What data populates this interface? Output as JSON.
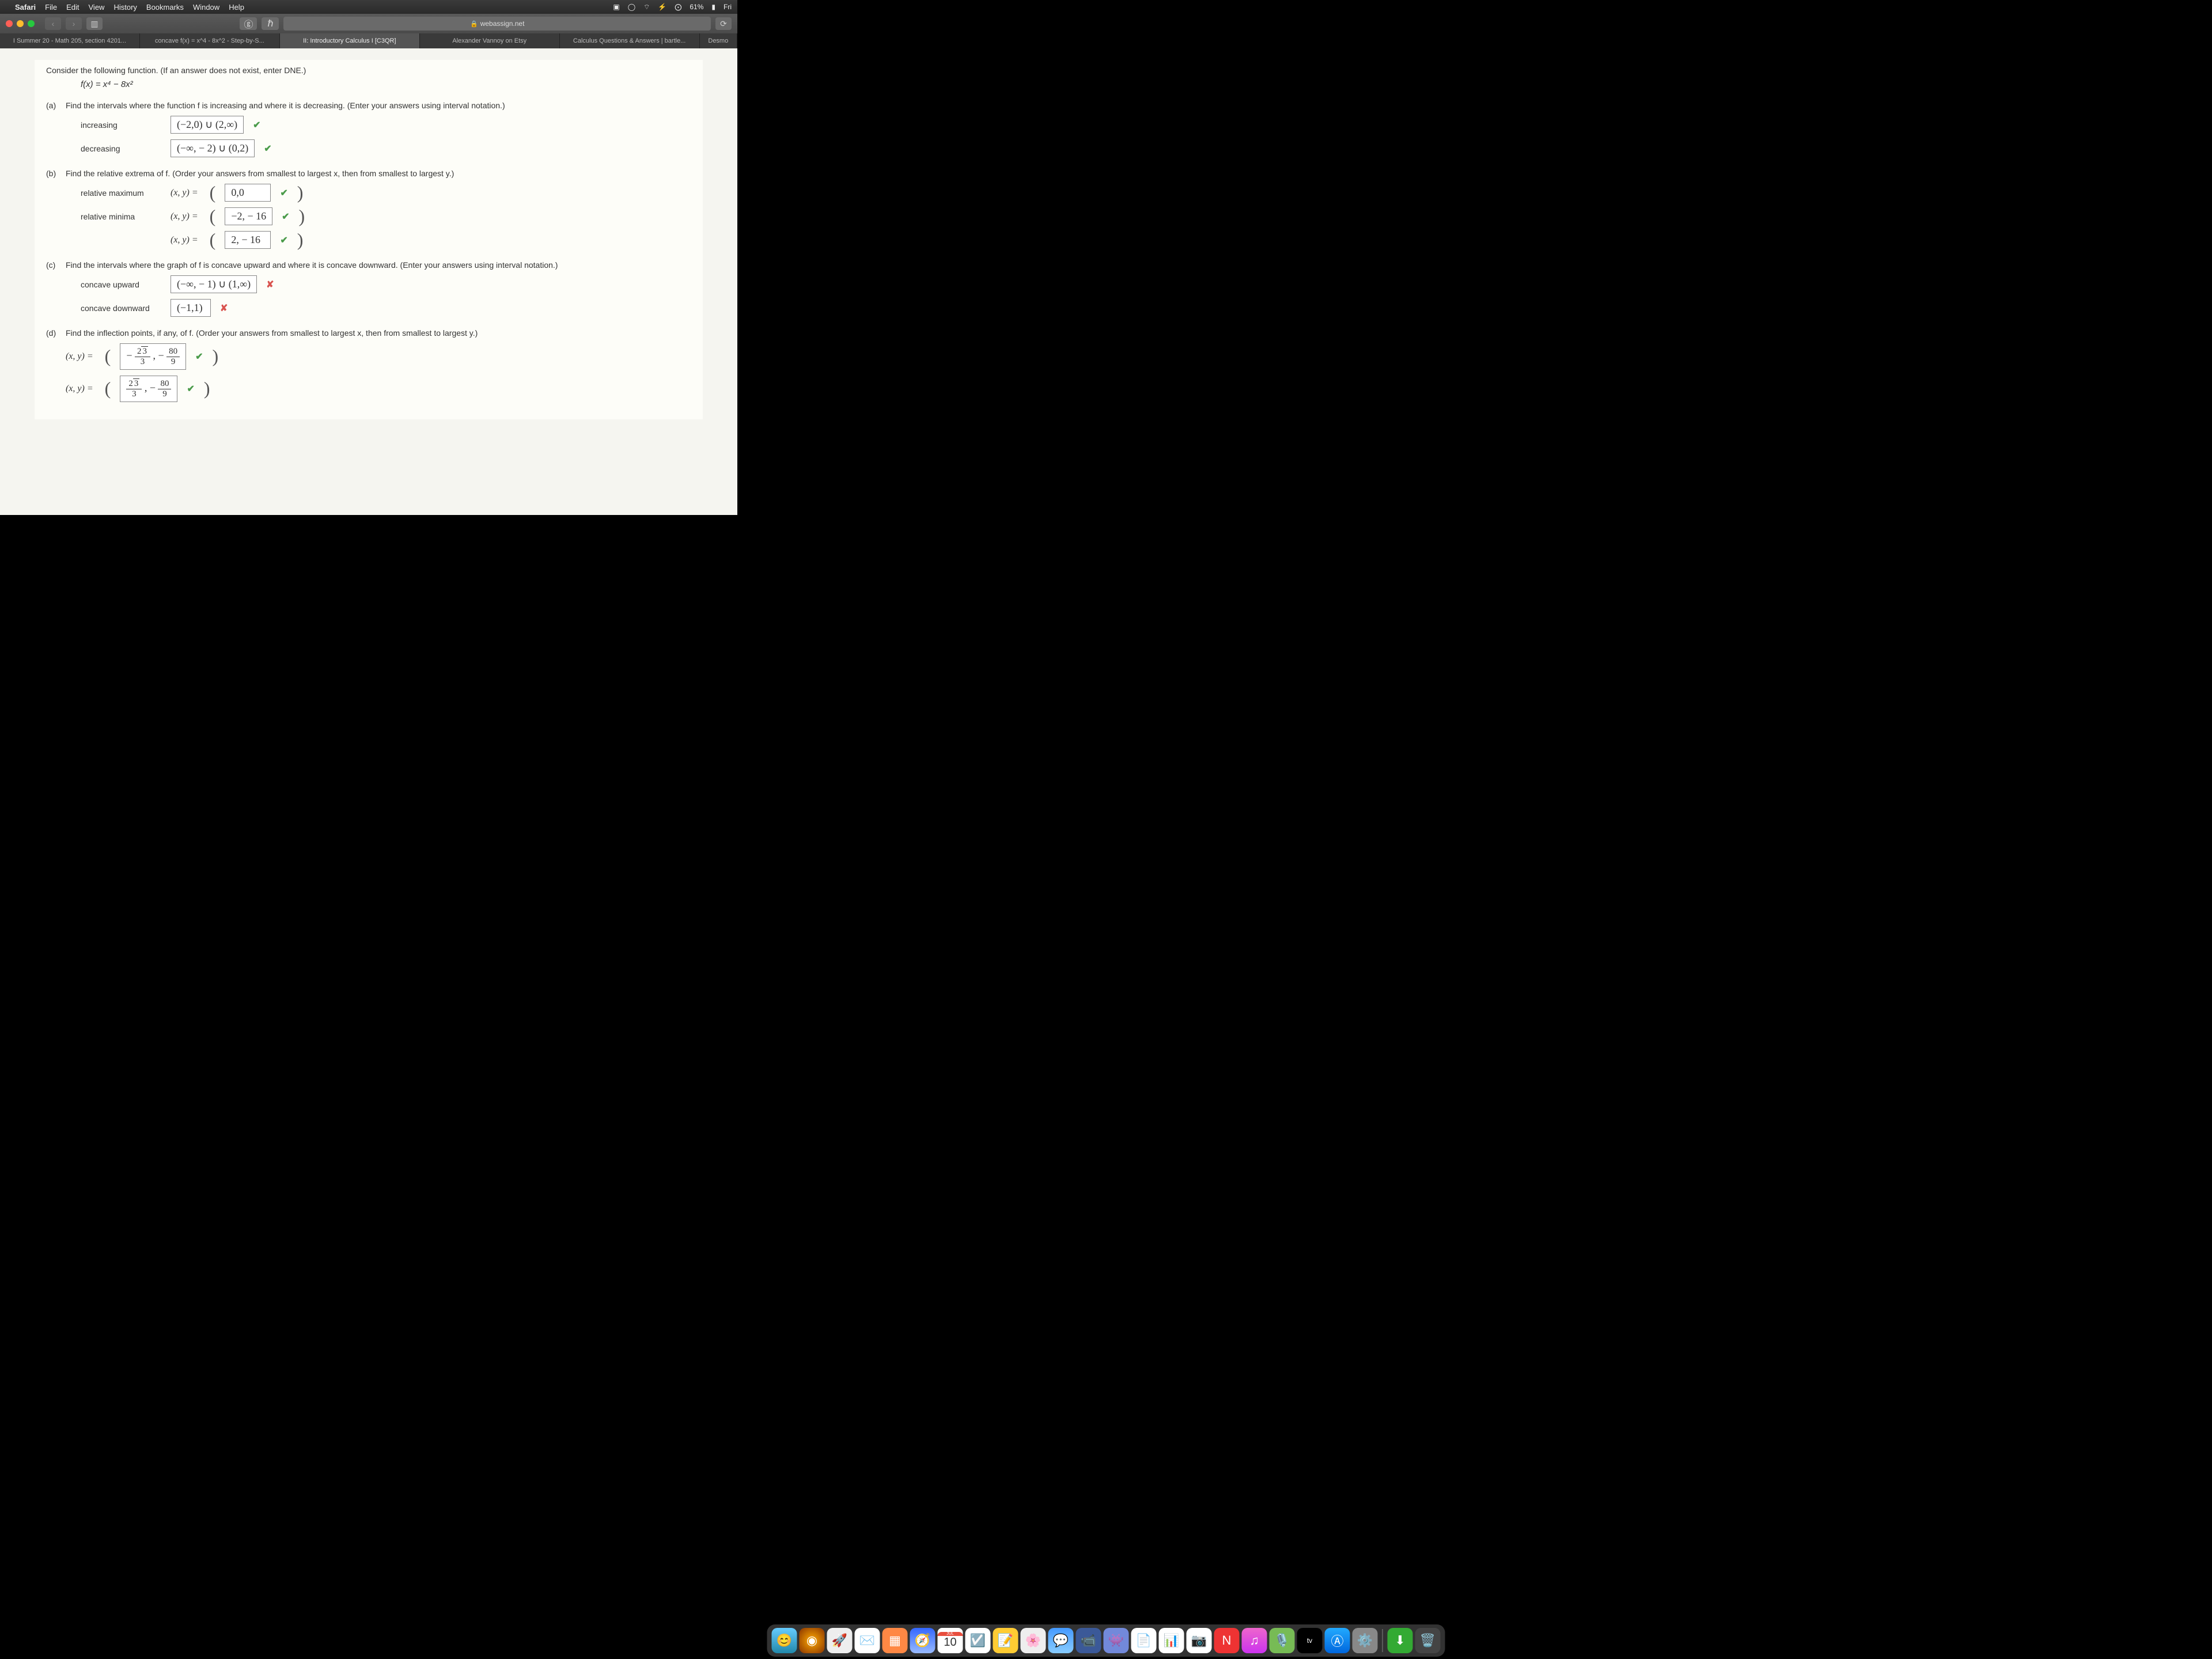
{
  "menubar": {
    "app": "Safari",
    "items": [
      "File",
      "Edit",
      "View",
      "History",
      "Bookmarks",
      "Window",
      "Help"
    ],
    "battery": "61%",
    "day": "Fri"
  },
  "browser": {
    "url": "webassign.net",
    "tabs": [
      "I Summer 20 - Math 205, section 4201...",
      "concave f(x) = x^4 - 8x^2 - Step-by-S...",
      "II: Introductory Calculus I [C3QR]",
      "Alexander Vannoy on Etsy",
      "Calculus Questions & Answers | bartle...",
      "Desmo"
    ],
    "active_tab": 2
  },
  "problem": {
    "prompt": "Consider the following function. (If an answer does not exist, enter DNE.)",
    "function": "f(x) = x⁴ − 8x²",
    "a": {
      "question": "Find the intervals where the function f is increasing and where it is decreasing. (Enter your answers using interval notation.)",
      "increasing_label": "increasing",
      "increasing_ans": "(−2,0) ∪ (2,∞)",
      "decreasing_label": "decreasing",
      "decreasing_ans": "(−∞, − 2) ∪ (0,2)"
    },
    "b": {
      "question": "Find the relative extrema of f. (Order your answers from smallest to largest x, then from smallest to largest y.)",
      "max_label": "relative maximum",
      "min_label": "relative minima",
      "max_ans": "0,0",
      "min1_ans": "−2, − 16",
      "min2_ans": "2, − 16"
    },
    "c": {
      "question": "Find the intervals where the graph of f is concave upward and where it is concave downward. (Enter your answers using interval notation.)",
      "up_label": "concave upward",
      "up_ans": "(−∞, − 1) ∪ (1,∞)",
      "down_label": "concave downward",
      "down_ans": "(−1,1)"
    },
    "d": {
      "question": "Find the inflection points, if any, of f. (Order your answers from smallest to largest x, then from smallest to largest y.)"
    }
  },
  "dock": {
    "calendar_month": "JUL",
    "calendar_day": "10",
    "tv_label": "tv"
  }
}
